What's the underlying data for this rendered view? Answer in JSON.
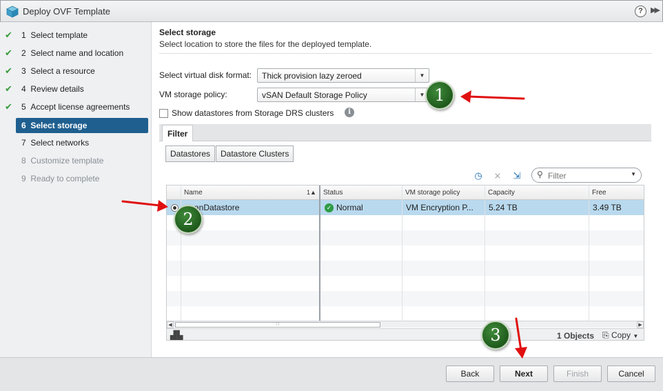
{
  "window": {
    "title": "Deploy OVF Template",
    "help_label": "?",
    "expand_label": "▶▶"
  },
  "steps": [
    {
      "num": "1",
      "label": "Select template",
      "done": true
    },
    {
      "num": "2",
      "label": "Select name and location",
      "done": true
    },
    {
      "num": "3",
      "label": "Select a resource",
      "done": true
    },
    {
      "num": "4",
      "label": "Review details",
      "done": true
    },
    {
      "num": "5",
      "label": "Accept license agreements",
      "done": true
    },
    {
      "num": "6",
      "label": "Select storage",
      "active": true
    },
    {
      "num": "7",
      "label": "Select networks"
    },
    {
      "num": "8",
      "label": "Customize template",
      "disabled": true
    },
    {
      "num": "9",
      "label": "Ready to complete",
      "disabled": true
    }
  ],
  "section": {
    "title": "Select storage",
    "description": "Select location to store the files for the deployed template."
  },
  "form": {
    "disk_format_label": "Select virtual disk format:",
    "disk_format_value": "Thick provision lazy zeroed",
    "policy_label": "VM storage policy:",
    "policy_value": "vSAN Default Storage Policy",
    "show_drs_label": "Show datastores from Storage DRS clusters",
    "show_drs_checked": false
  },
  "filter_tab": "Filter",
  "toggle_buttons": {
    "datastores": "Datastores",
    "clusters": "Datastore Clusters"
  },
  "filter_placeholder": "Filter",
  "grid": {
    "columns": [
      "Name",
      "Status",
      "VM storage policy",
      "Capacity",
      "Free"
    ],
    "sort_indicator": "1▲",
    "rows": [
      {
        "name": "vsanDatastore",
        "status": "Normal",
        "policy": "VM Encryption P...",
        "capacity": "5.24  TB",
        "free": "3.49  TB",
        "selected": true
      }
    ],
    "objects_count": "1 Objects",
    "copy_label": "Copy"
  },
  "buttons": {
    "back": "Back",
    "next": "Next",
    "finish": "Finish",
    "cancel": "Cancel"
  },
  "annotations": [
    "1",
    "2",
    "3"
  ],
  "colors": {
    "active_step": "#1f5f8f",
    "selected_row": "#b9d9ee",
    "check": "#3a9a3a",
    "annotation_circle": "#2f7a2a",
    "arrow": "#e01010"
  }
}
